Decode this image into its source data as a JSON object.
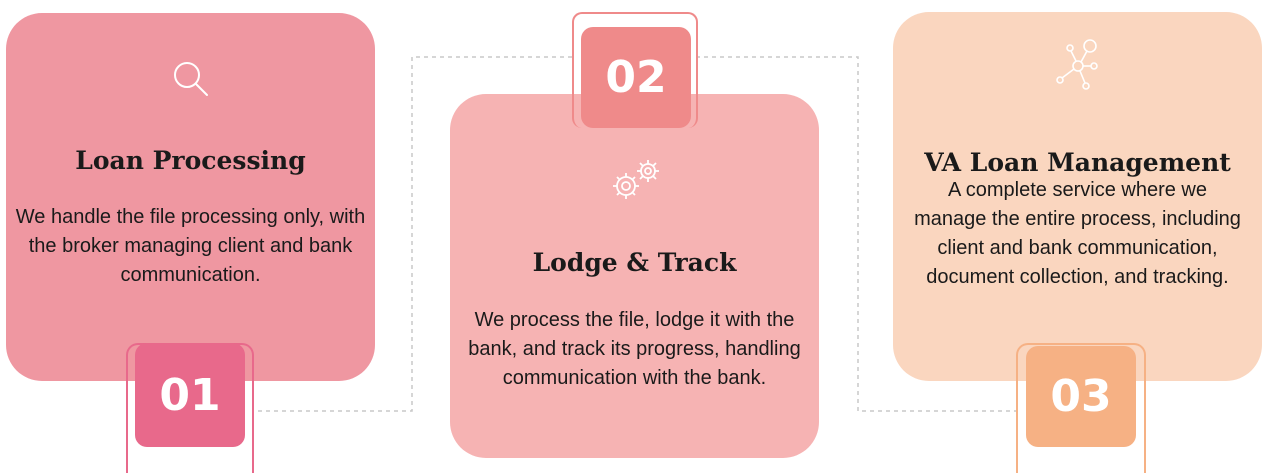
{
  "steps": [
    {
      "number": "01",
      "title": "Loan Processing",
      "description": "We handle the file processing only, with the broker managing client and bank communication.",
      "icon": "search-icon",
      "color": "#ef97a1",
      "badge_color": "#e8698b"
    },
    {
      "number": "02",
      "title": "Lodge & Track",
      "description": "We process the file, lodge it with the bank, and track its progress, handling communication with the bank.",
      "icon": "gears-icon",
      "color": "#f6b3b3",
      "badge_color": "#ef8a8a"
    },
    {
      "number": "03",
      "title": "VA Loan Management",
      "description": "A complete service where we manage the entire process, including client and bank communication, document collection, and tracking.",
      "icon": "network-icon",
      "color": "#fad6bf",
      "badge_color": "#f6b184"
    }
  ]
}
